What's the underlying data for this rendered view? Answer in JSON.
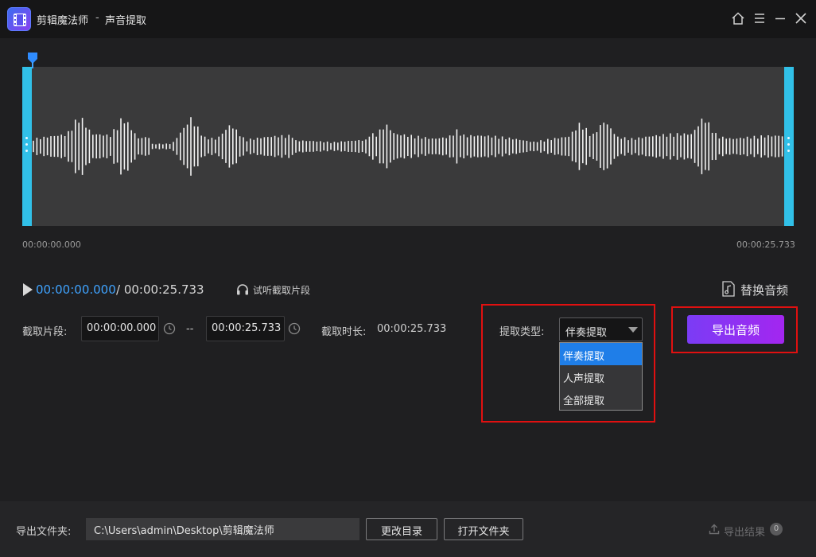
{
  "header": {
    "app_name": "剪辑魔法师",
    "separator": "-",
    "page_title": "声音提取"
  },
  "waveform": {
    "start_label": "00:00:00.000",
    "end_label": "00:00:25.733",
    "handle_color": "#31c0e8"
  },
  "playback": {
    "current_time": "00:00:00.000",
    "total_time": "/ 00:00:25.733",
    "preview_label": "试听截取片段",
    "replace_audio_label": "替换音频"
  },
  "clip": {
    "segment_label": "截取片段:",
    "start_value": "00:00:00.000",
    "dash": "--",
    "end_value": "00:00:25.733",
    "duration_label": "截取时长:",
    "duration_value": "00:00:25.733"
  },
  "extract": {
    "type_label": "提取类型:",
    "selected": "伴奏提取",
    "options": [
      "伴奏提取",
      "人声提取",
      "全部提取"
    ]
  },
  "export": {
    "button_label": "导出音频",
    "accent_color": "#8a32f2"
  },
  "footer": {
    "folder_label": "导出文件夹:",
    "folder_path": "C:\\Users\\admin\\Desktop\\剪辑魔法师",
    "change_dir_label": "更改目录",
    "open_folder_label": "打开文件夹",
    "results_label": "导出结果",
    "results_count": "0"
  },
  "icons": {
    "home": "home-icon",
    "menu": "menu-icon",
    "minimize": "minimize-icon",
    "close": "close-icon",
    "play": "play-icon",
    "headphones": "headphones-icon",
    "music_file": "music-file-icon",
    "clock": "clock-reset-icon",
    "upload": "upload-icon"
  }
}
